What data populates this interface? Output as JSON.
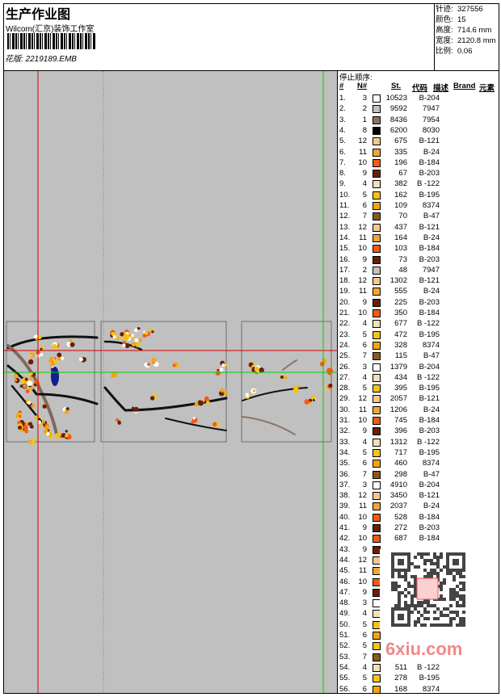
{
  "header": {
    "title": "生产作业图",
    "studio": "Wilcom(汇京)装饰工作室",
    "design_label": "花版:",
    "design_file": "2219189.EMB"
  },
  "info": [
    {
      "k": "针迹:",
      "v": "327556"
    },
    {
      "k": "颜色:",
      "v": "15"
    },
    {
      "k": "高度:",
      "v": "714.6 mm"
    },
    {
      "k": "宽度:",
      "v": "2120.8 mm"
    },
    {
      "k": "比例:",
      "v": "0.06"
    }
  ],
  "table": {
    "stop_sequence_label": "停止顺序:",
    "headers": [
      "#",
      "N#",
      "St.",
      "代码",
      "描述",
      "Brand",
      "元素"
    ],
    "colors": {
      "1": "#8c6e60",
      "2": "#c8c0b8",
      "3": "#ffffff",
      "4": "#f0e2b8",
      "5": "#f2c414",
      "6": "#f2a412",
      "7": "#8a5a18",
      "8": "#000000",
      "9": "#6a2008",
      "10": "#f85812",
      "11": "#f2a434",
      "12": "#f0c890"
    },
    "rows": [
      [
        "1.",
        "3",
        "10523",
        "B-204"
      ],
      [
        "2.",
        "2",
        "9592",
        "7947"
      ],
      [
        "3.",
        "1",
        "8436",
        "7954"
      ],
      [
        "4.",
        "8",
        "6200",
        "8030"
      ],
      [
        "5.",
        "12",
        "675",
        "B-121"
      ],
      [
        "6.",
        "11",
        "335",
        "B-24"
      ],
      [
        "7.",
        "10",
        "196",
        "B-184"
      ],
      [
        "8.",
        "9",
        "67",
        "B-203"
      ],
      [
        "9.",
        "4",
        "382",
        "B -122"
      ],
      [
        "10.",
        "5",
        "162",
        "B-195"
      ],
      [
        "11.",
        "6",
        "109",
        "8374"
      ],
      [
        "12.",
        "7",
        "70",
        "B-47"
      ],
      [
        "13.",
        "12",
        "437",
        "B-121"
      ],
      [
        "14.",
        "11",
        "164",
        "B-24"
      ],
      [
        "15.",
        "10",
        "103",
        "B-184"
      ],
      [
        "16.",
        "9",
        "73",
        "B-203"
      ],
      [
        "17.",
        "2",
        "48",
        "7947"
      ],
      [
        "18.",
        "12",
        "1302",
        "B-121"
      ],
      [
        "19.",
        "11",
        "555",
        "B-24"
      ],
      [
        "20.",
        "9",
        "225",
        "B-203"
      ],
      [
        "21.",
        "10",
        "350",
        "B-184"
      ],
      [
        "22.",
        "4",
        "677",
        "B -122"
      ],
      [
        "23.",
        "5",
        "472",
        "B-195"
      ],
      [
        "24.",
        "6",
        "328",
        "8374"
      ],
      [
        "25.",
        "7",
        "115",
        "B-47"
      ],
      [
        "26.",
        "3",
        "1379",
        "B-204"
      ],
      [
        "27.",
        "4",
        "434",
        "B -122"
      ],
      [
        "28.",
        "5",
        "395",
        "B-195"
      ],
      [
        "29.",
        "12",
        "2057",
        "B-121"
      ],
      [
        "30.",
        "11",
        "1206",
        "B-24"
      ],
      [
        "31.",
        "10",
        "745",
        "B-184"
      ],
      [
        "32.",
        "9",
        "396",
        "B-203"
      ],
      [
        "33.",
        "4",
        "1312",
        "B -122"
      ],
      [
        "34.",
        "5",
        "717",
        "B-195"
      ],
      [
        "35.",
        "6",
        "460",
        "8374"
      ],
      [
        "36.",
        "7",
        "298",
        "B-47"
      ],
      [
        "37.",
        "3",
        "4910",
        "B-204"
      ],
      [
        "38.",
        "12",
        "3450",
        "B-121"
      ],
      [
        "39.",
        "11",
        "2037",
        "B-24"
      ],
      [
        "40.",
        "10",
        "528",
        "B-184"
      ],
      [
        "41.",
        "9",
        "272",
        "B-203"
      ],
      [
        "42.",
        "10",
        "687",
        "B-184"
      ],
      [
        "43.",
        "9",
        "",
        ""
      ],
      [
        "44.",
        "12",
        "",
        ""
      ],
      [
        "45.",
        "11",
        "",
        ""
      ],
      [
        "46.",
        "10",
        "",
        ""
      ],
      [
        "47.",
        "9",
        "",
        ""
      ],
      [
        "48.",
        "3",
        "",
        ""
      ],
      [
        "49.",
        "4",
        "",
        ""
      ],
      [
        "50.",
        "5",
        "",
        ""
      ],
      [
        "51.",
        "6",
        "",
        ""
      ],
      [
        "52.",
        "5",
        "",
        ""
      ],
      [
        "53.",
        "7",
        "",
        ""
      ],
      [
        "54.",
        "4",
        "511",
        "B -122"
      ],
      [
        "55.",
        "5",
        "278",
        "B-195"
      ],
      [
        "56.",
        "6",
        "168",
        "8374"
      ]
    ]
  },
  "watermark": {
    "text": "6xiu.com",
    "stamp": "以图搜图"
  }
}
